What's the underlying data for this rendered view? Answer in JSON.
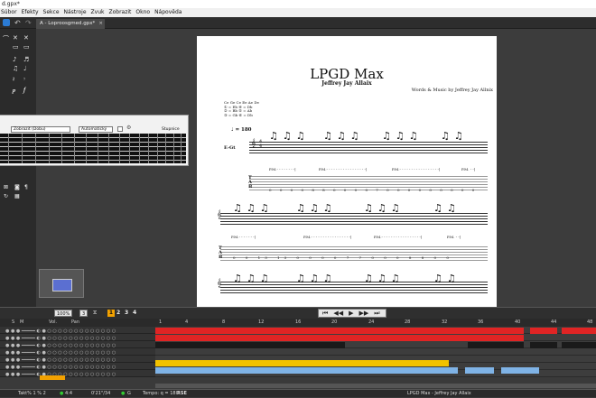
{
  "window": {
    "title": "d.gpx*"
  },
  "menu": [
    "Súbor",
    "Efekty",
    "Sekce",
    "Nástroje",
    "Zvuk",
    "Zobrazit",
    "Okno",
    "Nápověda"
  ],
  "tabs": [
    {
      "label": "A - Loproosgmed.gpx*"
    }
  ],
  "score": {
    "title": "LPGD Max",
    "artist": "Jeffrey Jay Allaix",
    "credits": "Words & Music by Jeffrey Jay Allnix",
    "tuning": [
      "Ce Ge Ce Ee Ae De",
      "① = Eb  ④ = Db",
      "② = Bb  ⑤ = Ab",
      "③ = Gb  ⑥ = Db"
    ],
    "tempo": "♩ = 180",
    "track_short": "E-Gt",
    "pm_marks": [
      "P.M.- - - - - - - -|",
      "P.M.- - - - - - - - - - - - - - - - -|",
      "P.M.- - - - - - - - - - - - - - - - -|",
      "P.M. - -|"
    ],
    "pm_marks2": [
      "P.M.- - - - - - -|",
      "P.M.- - - - - - - - - - - - - - - - -|",
      "P.M.- - - - - - - - - - - - - - - - -|",
      "P.M. - -|"
    ],
    "tab_numbers_row1": [
      "0",
      "0",
      "0",
      "0",
      "8",
      "8",
      "0",
      "0",
      "0",
      "0",
      "7",
      "0",
      "0",
      "0",
      "0",
      "0",
      "0",
      "0",
      "0",
      "0"
    ],
    "tab_numbers_row2": [
      "0",
      "0",
      "13",
      "13",
      "0",
      "0",
      "0",
      "0",
      "7",
      "7",
      "0",
      "0",
      "0",
      "8",
      "8",
      "0",
      "0"
    ]
  },
  "fretboard": {
    "select1": "Zobrazit (Dobu)",
    "select2": "Automatický",
    "settings_label": "Stupnice"
  },
  "transport": {
    "zoom": "100%",
    "page_num": "3",
    "beats": [
      "1",
      "2",
      "3",
      "4"
    ]
  },
  "tracks": {
    "header": {
      "col_s": "S",
      "col_m": "M",
      "col_vol": "Vol.",
      "col_pan": "Pan"
    },
    "timeline_marks": [
      "1",
      "4",
      "8",
      "12",
      "16",
      "20",
      "24",
      "28",
      "32",
      "36",
      "40",
      "44",
      "48"
    ]
  },
  "status": {
    "position": "Takt% 1 % 2",
    "signature": "4:4",
    "time": "0'21\"/34",
    "key": "G",
    "tempo": "Tempo: q = 180",
    "rse": "RSE",
    "song_info": "LPGD Max - Jeffrey Jay Allaix"
  },
  "colors": {
    "track_red": "#e02424",
    "track_yellow": "#f2c200",
    "track_blue": "#7fb3e6",
    "track_black": "#1a1a1a"
  }
}
